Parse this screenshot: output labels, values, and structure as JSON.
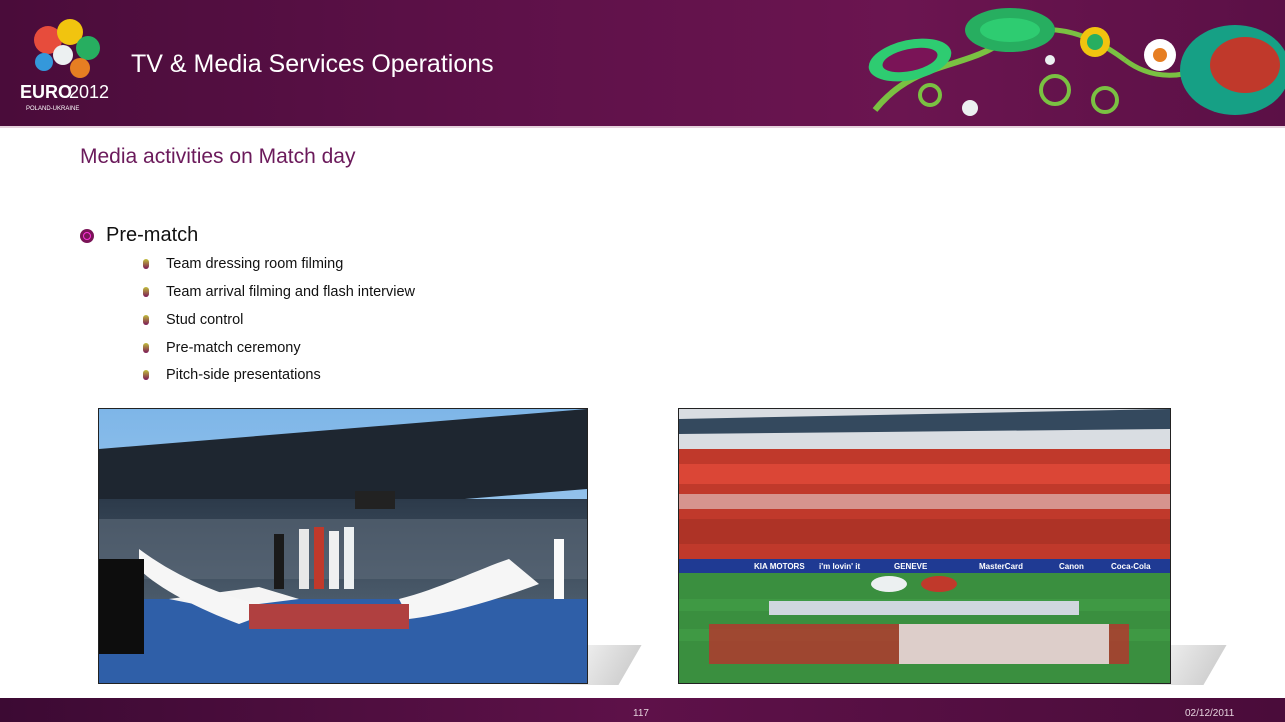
{
  "header": {
    "title": "TV & Media Services Operations",
    "logo_text": "EURO2012",
    "logo_subtext": "POLAND-UKRAINE"
  },
  "slide": {
    "subtitle": "Media activities on Match day",
    "section": "Pre-match",
    "items": [
      "Team dressing room filming",
      "Team arrival filming and flash interview",
      "Stud control",
      "Pre-match ceremony",
      "Pitch-side presentations"
    ]
  },
  "photos": {
    "left": {
      "board": ""
    },
    "right": {
      "ad_boards": [
        "KIA MOTORS",
        "i'm lovin' it",
        "GENEVE",
        "MasterCard",
        "Canon",
        "Coca-Cola"
      ]
    }
  },
  "footer": {
    "page": "117",
    "date": "02/12/2011"
  },
  "colors": {
    "header": "#5e1149",
    "accent": "#6b1a5b"
  }
}
